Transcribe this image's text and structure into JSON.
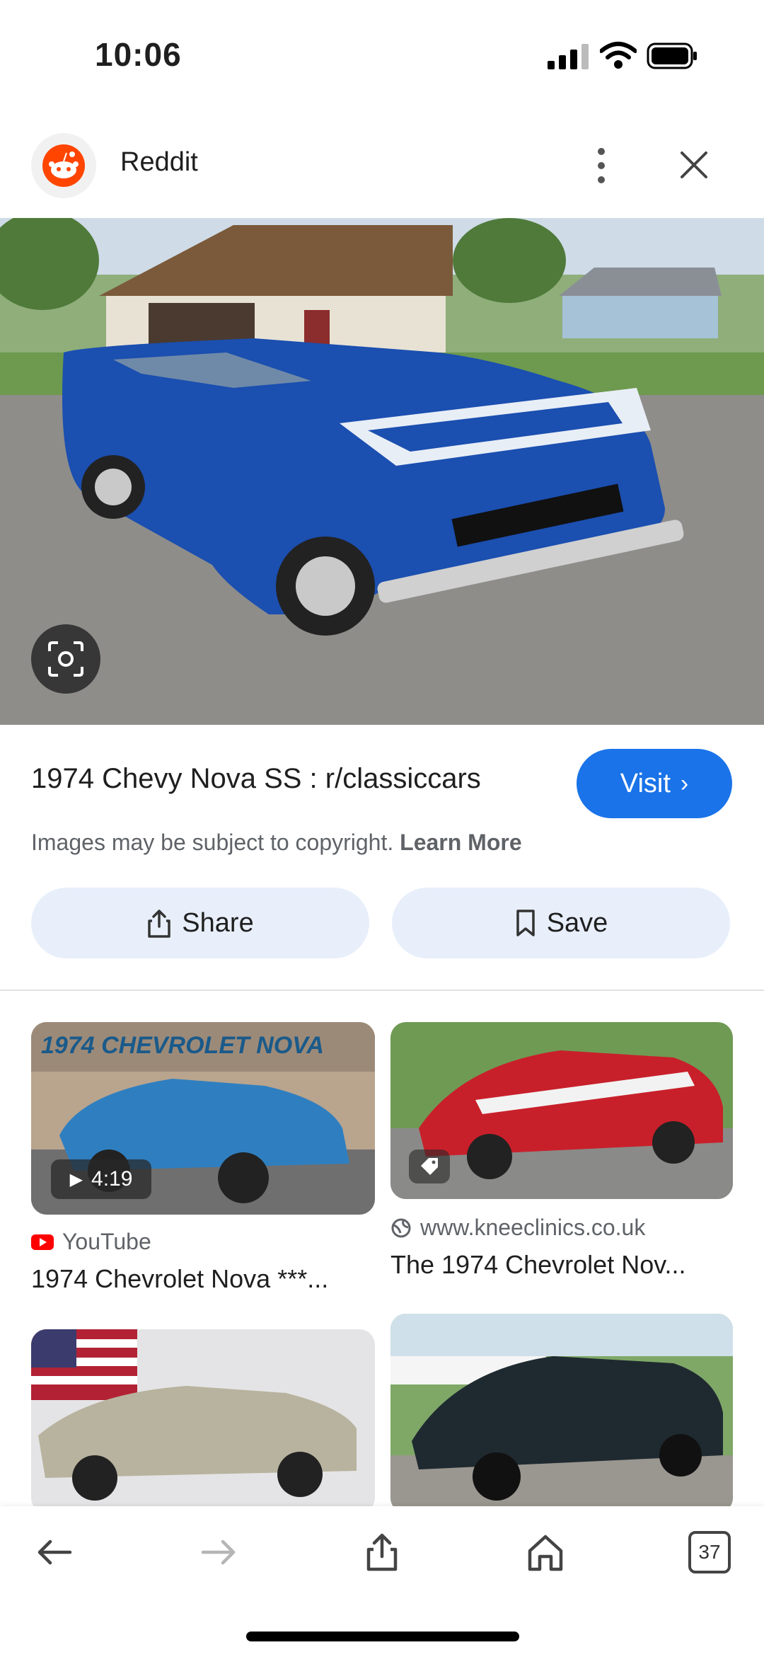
{
  "status_bar": {
    "time": "10:06"
  },
  "header": {
    "site_name": "Reddit"
  },
  "result": {
    "title": "1974 Chevy Nova SS : r/classiccars",
    "visit_label": "Visit",
    "copyright_text": "Images may be subject to copyright.",
    "learn_more_label": "Learn More",
    "share_label": "Share",
    "save_label": "Save"
  },
  "related": [
    {
      "overlay_title": "1974 CHEVROLET NOVA",
      "duration": "4:19",
      "source": "YouTube",
      "caption": "1974 Chevrolet Nova ***..."
    },
    {
      "source": "www.kneeclinics.co.uk",
      "caption": "The 1974 Chevrolet Nov..."
    }
  ],
  "bottom_nav": {
    "tab_count": "37"
  },
  "colors": {
    "accent": "#1a73e8",
    "pill_bg": "#e8effb",
    "youtube": "#ff0000"
  },
  "icons": [
    "signal-icon",
    "wifi-icon",
    "battery-icon",
    "reddit-icon",
    "more-vert-icon",
    "close-icon",
    "lens-icon",
    "chevron-right-icon",
    "share-icon",
    "bookmark-icon",
    "play-icon",
    "tag-icon",
    "globe-icon",
    "back-arrow-icon",
    "forward-arrow-icon",
    "home-icon",
    "tabs-icon"
  ]
}
